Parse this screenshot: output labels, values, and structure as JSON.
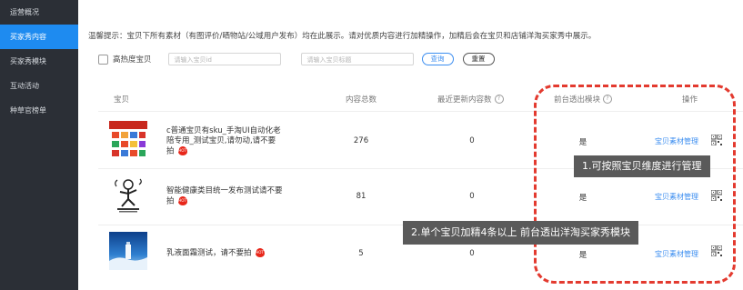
{
  "sidebar": {
    "items": [
      {
        "label": "运营概况",
        "active": false
      },
      {
        "label": "买家秀内容",
        "active": true
      },
      {
        "label": "买家秀模块",
        "active": false
      },
      {
        "label": "互动活动",
        "active": false
      },
      {
        "label": "种草官榜单",
        "active": false
      }
    ]
  },
  "notice": "温馨提示：宝贝下所有素材（有图评价/晒物站/公域用户发布）均在此展示。请对优质内容进行加精操作，加精后会在宝贝和店铺洋淘买家秀中展示。",
  "filter": {
    "checkbox_label": "高热度宝贝",
    "item_id_placeholder": "请输入宝贝id",
    "item_title_placeholder": "请输入宝贝标题",
    "query_label": "查询",
    "reset_label": "重置"
  },
  "table": {
    "headers": {
      "item": "宝贝",
      "total": "内容总数",
      "recent": "最近更新内容数",
      "frontend": "前台透出模块",
      "action": "操作"
    },
    "rows": [
      {
        "title": "c普通宝贝有sku_手淘UI自动化老陪专用_测试宝贝,请勿动,请不要拍",
        "total": "276",
        "recent": "0",
        "frontend": "是",
        "action": "宝贝素材管理",
        "hot": "HOT"
      },
      {
        "title": "智能健康类目统一发布测试请不要拍",
        "total": "81",
        "recent": "0",
        "frontend": "是",
        "action": "宝贝素材管理",
        "hot": "HOT"
      },
      {
        "title": "乳液面霜测试，请不要拍",
        "total": "5",
        "recent": "0",
        "frontend": "是",
        "action": "宝贝素材管理",
        "hot": "HOT"
      }
    ]
  },
  "annotations": {
    "note1": "1.可按照宝贝维度进行管理",
    "note2": "2.单个宝贝加精4条以上 前台透出洋淘买家秀模块",
    "accent": "#e33a2f"
  },
  "colors": {
    "sidebar_bg": "#2b2f36",
    "active_bg": "#1e8bf0",
    "link": "#3c8ef0"
  }
}
